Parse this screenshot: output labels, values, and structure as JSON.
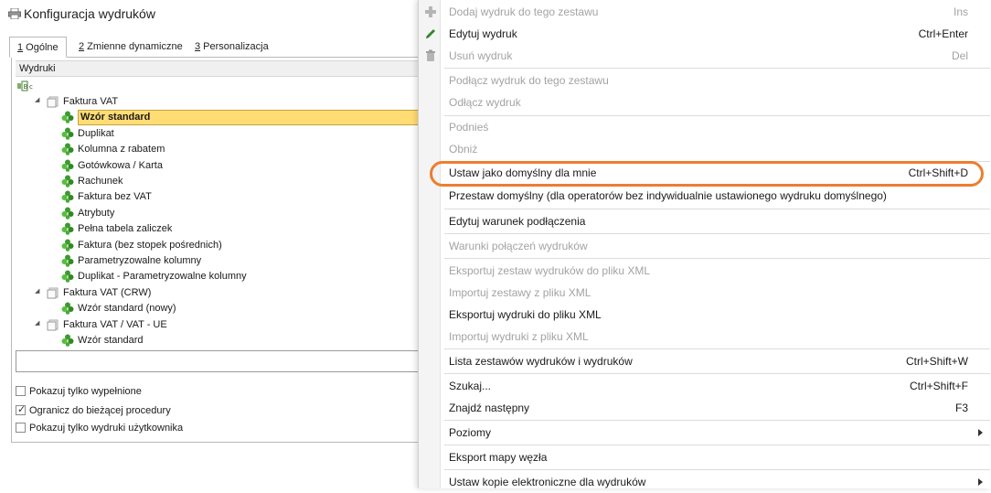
{
  "window": {
    "title": "Konfiguracja wydruków",
    "icon": "printer-icon"
  },
  "tabs": [
    {
      "key": "1",
      "label": " Ogólne"
    },
    {
      "key": "2",
      "label": " Zmienne dynamiczne"
    },
    {
      "key": "3",
      "label": " Personalizacja"
    }
  ],
  "grid": {
    "header": "Wydruki",
    "tree": [
      {
        "label": "Faktura VAT",
        "level": 0,
        "type": "group"
      },
      {
        "label": "Wzór standard",
        "level": 1,
        "type": "leaf",
        "selected": true
      },
      {
        "label": "Duplikat",
        "level": 1,
        "type": "leaf"
      },
      {
        "label": "Kolumna z rabatem",
        "level": 1,
        "type": "leaf"
      },
      {
        "label": "Gotówkowa / Karta",
        "level": 1,
        "type": "leaf"
      },
      {
        "label": "Rachunek",
        "level": 1,
        "type": "leaf"
      },
      {
        "label": "Faktura bez VAT",
        "level": 1,
        "type": "leaf"
      },
      {
        "label": "Atrybuty",
        "level": 1,
        "type": "leaf"
      },
      {
        "label": "Pełna tabela zaliczek",
        "level": 1,
        "type": "leaf"
      },
      {
        "label": "Faktura (bez stopek pośrednich)",
        "level": 1,
        "type": "leaf"
      },
      {
        "label": "Parametryzowalne kolumny",
        "level": 1,
        "type": "leaf"
      },
      {
        "label": "Duplikat - Parametryzowalne kolumny",
        "level": 1,
        "type": "leaf"
      },
      {
        "label": "Faktura VAT (CRW)",
        "level": 0,
        "type": "group"
      },
      {
        "label": "Wzór standard (nowy)",
        "level": 1,
        "type": "leaf"
      },
      {
        "label": "Faktura VAT / VAT - UE",
        "level": 0,
        "type": "group"
      },
      {
        "label": "Wzór standard",
        "level": 1,
        "type": "leaf"
      }
    ],
    "search_value": ""
  },
  "options": [
    {
      "label": "Pokazuj tylko wypełnione",
      "checked": false
    },
    {
      "label": "Ogranicz do bieżącej procedury",
      "checked": true
    },
    {
      "label": "Pokazuj tylko wydruki użytkownika",
      "checked": false
    }
  ],
  "menu": {
    "items": [
      {
        "label": "Dodaj wydruk do tego zestawu",
        "shortcut": "Ins",
        "disabled": true,
        "icon": "plus-icon"
      },
      {
        "label": "Edytuj wydruk",
        "shortcut": "Ctrl+Enter",
        "disabled": false,
        "icon": "edit-pen-icon"
      },
      {
        "label": "Usuń wydruk",
        "shortcut": "Del",
        "disabled": true,
        "icon": "trash-icon"
      },
      {
        "sep": true
      },
      {
        "label": "Podłącz wydruk do tego zestawu",
        "shortcut": "",
        "disabled": true
      },
      {
        "label": "Odłącz wydruk",
        "shortcut": "",
        "disabled": true
      },
      {
        "sep": true
      },
      {
        "label": "Podnieś",
        "shortcut": "",
        "disabled": true
      },
      {
        "label": "Obniż",
        "shortcut": "",
        "disabled": true
      },
      {
        "sep": true
      },
      {
        "label": "Ustaw jako domyślny dla mnie",
        "shortcut": "Ctrl+Shift+D",
        "disabled": false,
        "highlighted": true
      },
      {
        "label": "Przestaw domyślny (dla operatorów bez indywidualnie ustawionego wydruku domyślnego)",
        "shortcut": "",
        "disabled": false
      },
      {
        "sep": true
      },
      {
        "label": "Edytuj warunek podłączenia",
        "shortcut": "",
        "disabled": false
      },
      {
        "sep": true
      },
      {
        "label": "Warunki połączeń wydruków",
        "shortcut": "",
        "disabled": true
      },
      {
        "sep": true
      },
      {
        "label": "Eksportuj zestaw wydruków do pliku XML",
        "shortcut": "",
        "disabled": true
      },
      {
        "label": "Importuj zestawy z pliku XML",
        "shortcut": "",
        "disabled": true
      },
      {
        "label": "Eksportuj wydruki do pliku XML",
        "shortcut": "",
        "disabled": false
      },
      {
        "label": "Importuj wydruki z pliku XML",
        "shortcut": "",
        "disabled": true
      },
      {
        "sep": true
      },
      {
        "label": "Lista zestawów wydruków i wydruków",
        "shortcut": "Ctrl+Shift+W",
        "disabled": false
      },
      {
        "sep": true
      },
      {
        "label": "Szukaj...",
        "shortcut": "Ctrl+Shift+F",
        "disabled": false
      },
      {
        "label": "Znajdź następny",
        "shortcut": "F3",
        "disabled": false
      },
      {
        "sep": true
      },
      {
        "label": "Poziomy",
        "shortcut": "",
        "disabled": false,
        "submenu": true
      },
      {
        "sep": true
      },
      {
        "label": "Eksport mapy węzła",
        "shortcut": "",
        "disabled": false
      },
      {
        "sep": true
      },
      {
        "label": "Ustaw kopie elektroniczne dla wydruków",
        "shortcut": "",
        "disabled": false,
        "submenu": true
      }
    ]
  },
  "colors": {
    "selection": "#ffdd74",
    "highlight_ring": "#ed7d31",
    "disabled_text": "#a3a3a3",
    "leaf_icon": "#3c9a2e"
  }
}
